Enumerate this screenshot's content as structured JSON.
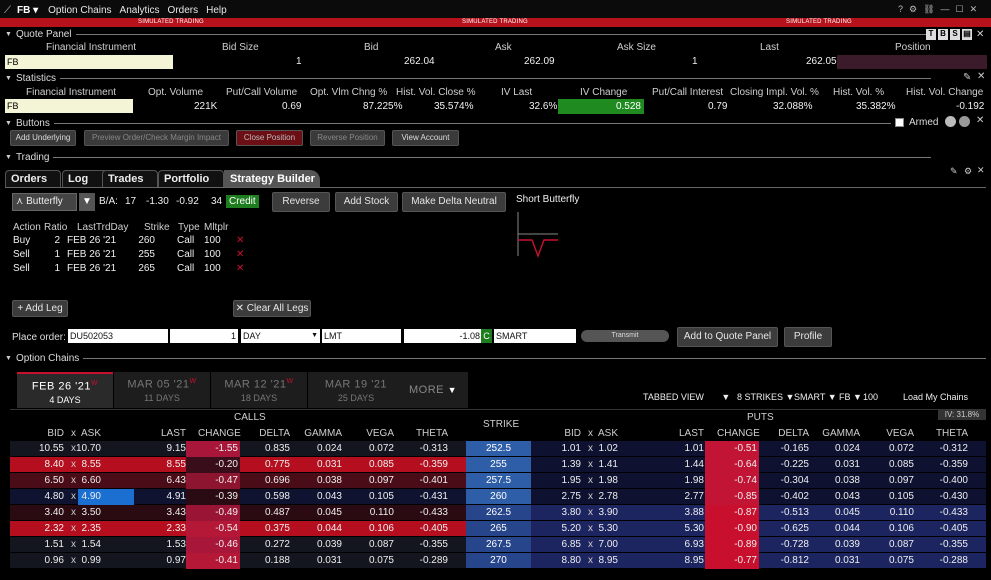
{
  "menu": {
    "symbol": "FB",
    "items": [
      "Option Chains",
      "Analytics",
      "Orders",
      "Help"
    ]
  },
  "sim_label": "SIMULATED TRADING",
  "quote_panel": {
    "title": "Quote Panel",
    "headers": [
      "Financial Instrument",
      "Bid Size",
      "Bid",
      "Ask",
      "Ask Size",
      "Last",
      "Position"
    ],
    "instrument": "FB",
    "bid_size": "1",
    "bid": "262.04",
    "ask": "262.09",
    "ask_size": "1",
    "last": "262.05",
    "position": ""
  },
  "statistics": {
    "title": "Statistics",
    "headers": [
      "Financial Instrument",
      "Opt. Volume",
      "Put/Call Volume",
      "Opt. Vlm Chng %",
      "Hist. Vol. Close %",
      "IV Last",
      "IV Change",
      "Put/Call Interest",
      "Closing Impl. Vol. %",
      "Hist. Vol. %",
      "Hist. Vol. Change"
    ],
    "values": [
      "FB",
      "221K",
      "0.69",
      "87.225%",
      "35.574%",
      "32.6%",
      "0.528",
      "0.79",
      "32.088%",
      "35.382%",
      "-0.192"
    ]
  },
  "buttons_panel": {
    "title": "Buttons",
    "buttons": [
      "Add Underlying",
      "Preview Order/Check Margin Impact",
      "Close Position",
      "Reverse Position",
      "View Account"
    ],
    "armed_label": "Armed"
  },
  "trading": {
    "title": "Trading",
    "tabs": [
      "Orders",
      "Log",
      "Trades",
      "Portfolio",
      "Strategy Builder"
    ],
    "strategy": "Butterfly",
    "ba_label": "B/A:",
    "ba_values": [
      "17",
      "-1.30",
      "-0.92",
      "34"
    ],
    "credit": "Credit",
    "reverse": "Reverse",
    "add_stock": "Add Stock",
    "make_delta_neutral": "Make Delta Neutral",
    "chart_title": "Short Butterfly",
    "leg_headers": [
      "Action",
      "Ratio",
      "LastTrdDay",
      "Strike",
      "Type",
      "Mltplr"
    ],
    "legs": [
      {
        "action": "Buy",
        "ratio": "2",
        "date": "FEB 26 '21",
        "strike": "260",
        "type": "Call",
        "mult": "100"
      },
      {
        "action": "Sell",
        "ratio": "1",
        "date": "FEB 26 '21",
        "strike": "255",
        "type": "Call",
        "mult": "100"
      },
      {
        "action": "Sell",
        "ratio": "1",
        "date": "FEB 26 '21",
        "strike": "265",
        "type": "Call",
        "mult": "100"
      }
    ],
    "add_leg": "+ Add Leg",
    "clear_legs": "Clear All Legs",
    "place_order_label": "Place order:",
    "account": "DU502053",
    "qty": "1",
    "tif": "DAY",
    "order_type": "LMT",
    "price": "-1.08",
    "price_flag": "C",
    "route": "SMART",
    "transmit": "Transmit",
    "add_to_quote": "Add to Quote Panel",
    "profile": "Profile"
  },
  "option_chains": {
    "title": "Option Chains",
    "expiries": [
      {
        "date": "FEB 26 '21",
        "sup": "W",
        "days": "4 DAYS"
      },
      {
        "date": "MAR 05 '21",
        "sup": "W",
        "days": "11 DAYS"
      },
      {
        "date": "MAR 12 '21",
        "sup": "W",
        "days": "18 DAYS"
      },
      {
        "date": "MAR 19 '21",
        "sup": "",
        "days": "25 DAYS"
      }
    ],
    "more": "MORE",
    "view": "TABBED VIEW",
    "strikes": "8 STRIKES",
    "exchange": "SMART",
    "underlying": "FB",
    "multiplier": "100",
    "load": "Load My Chains",
    "iv": "IV: 31.8%",
    "calls_label": "CALLS",
    "puts_label": "PUTS",
    "strike_label": "STRIKE",
    "call_headers": [
      "BID",
      "x",
      "ASK",
      "LAST",
      "CHANGE",
      "DELTA",
      "GAMMA",
      "VEGA",
      "THETA"
    ],
    "put_headers": [
      "BID",
      "x",
      "ASK",
      "LAST",
      "CHANGE",
      "DELTA",
      "GAMMA",
      "VEGA",
      "THETA"
    ],
    "rows": [
      {
        "cb": "10.55",
        "ca": "10.70",
        "cl": "9.15",
        "cc": "-1.55",
        "cd": "0.835",
        "cg": "0.024",
        "cv": "0.072",
        "ct": "-0.313",
        "k": "252.5",
        "pb": "1.01",
        "pa": "1.02",
        "pl": "1.01",
        "pc": "-0.51",
        "pd": "-0.165",
        "pg": "0.024",
        "pv": "0.072",
        "pt": "-0.312"
      },
      {
        "cb": "8.40",
        "ca": "8.55",
        "cl": "8.55",
        "cc": "-0.20",
        "cd": "0.775",
        "cg": "0.031",
        "cv": "0.085",
        "ct": "-0.359",
        "k": "255",
        "pb": "1.39",
        "pa": "1.41",
        "pl": "1.44",
        "pc": "-0.64",
        "pd": "-0.225",
        "pg": "0.031",
        "pv": "0.085",
        "pt": "-0.359"
      },
      {
        "cb": "6.50",
        "ca": "6.60",
        "cl": "6.43",
        "cc": "-0.47",
        "cd": "0.696",
        "cg": "0.038",
        "cv": "0.097",
        "ct": "-0.401",
        "k": "257.5",
        "pb": "1.95",
        "pa": "1.98",
        "pl": "1.98",
        "pc": "-0.74",
        "pd": "-0.304",
        "pg": "0.038",
        "pv": "0.097",
        "pt": "-0.400"
      },
      {
        "cb": "4.80",
        "ca": "4.90",
        "cl": "4.91",
        "cc": "-0.39",
        "cd": "0.598",
        "cg": "0.043",
        "cv": "0.105",
        "ct": "-0.431",
        "k": "260",
        "pb": "2.75",
        "pa": "2.78",
        "pl": "2.77",
        "pc": "-0.85",
        "pd": "-0.402",
        "pg": "0.043",
        "pv": "0.105",
        "pt": "-0.430"
      },
      {
        "cb": "3.40",
        "ca": "3.50",
        "cl": "3.43",
        "cc": "-0.49",
        "cd": "0.487",
        "cg": "0.045",
        "cv": "0.110",
        "ct": "-0.433",
        "k": "262.5",
        "pb": "3.80",
        "pa": "3.90",
        "pl": "3.88",
        "pc": "-0.87",
        "pd": "-0.513",
        "pg": "0.045",
        "pv": "0.110",
        "pt": "-0.433"
      },
      {
        "cb": "2.32",
        "ca": "2.35",
        "cl": "2.33",
        "cc": "-0.54",
        "cd": "0.375",
        "cg": "0.044",
        "cv": "0.106",
        "ct": "-0.405",
        "k": "265",
        "pb": "5.20",
        "pa": "5.30",
        "pl": "5.30",
        "pc": "-0.90",
        "pd": "-0.625",
        "pg": "0.044",
        "pv": "0.106",
        "pt": "-0.405"
      },
      {
        "cb": "1.51",
        "ca": "1.54",
        "cl": "1.53",
        "cc": "-0.46",
        "cd": "0.272",
        "cg": "0.039",
        "cv": "0.087",
        "ct": "-0.355",
        "k": "267.5",
        "pb": "6.85",
        "pa": "7.00",
        "pl": "6.93",
        "pc": "-0.89",
        "pd": "-0.728",
        "pg": "0.039",
        "pv": "0.087",
        "pt": "-0.355"
      },
      {
        "cb": "0.96",
        "ca": "0.99",
        "cl": "0.97",
        "cc": "-0.41",
        "cd": "0.188",
        "cg": "0.031",
        "cv": "0.075",
        "ct": "-0.289",
        "k": "270",
        "pb": "8.80",
        "pa": "8.95",
        "pl": "8.95",
        "pc": "-0.77",
        "pd": "-0.812",
        "pg": "0.031",
        "pv": "0.075",
        "pt": "-0.288"
      }
    ]
  },
  "colors": {
    "sim": "#b5121b",
    "green": "#1f8a1f",
    "credit": "#1e7d1e",
    "strike": "#2f5ea8",
    "calls_red": "#c8102e",
    "puts_blue": "#232a66",
    "bid_highlight": "#1a6fd1"
  }
}
